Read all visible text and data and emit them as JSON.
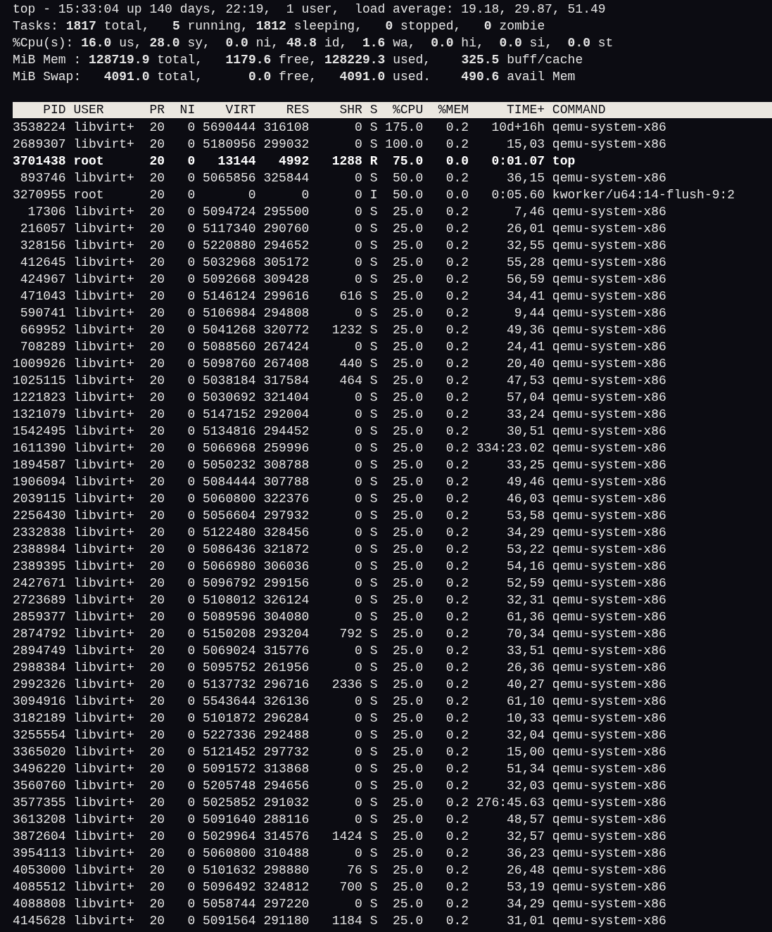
{
  "summary": [
    "top - 15:33:04 up 140 days, 22:19,  1 user,  load average: 19.18, 29.87, 51.49",
    "Tasks: **1817** total,   **5** running, **1812** sleeping,   **0** stopped,   **0** zombie",
    "%Cpu(s): **16.0** us, **28.0** sy,  **0.0** ni, **48.8** id,  **1.6** wa,  **0.0** hi,  **0.0** si,  **0.0** st",
    "MiB Mem : **128719.9** total,   **1179.6** free, **128229.3** used,    **325.5** buff/cache",
    "MiB Swap:   **4091.0** total,      **0.0** free,   **4091.0** used.    **490.6** avail Mem"
  ],
  "table": {
    "columns": [
      "PID",
      "USER",
      "PR",
      "NI",
      "VIRT",
      "RES",
      "SHR",
      "S",
      "%CPU",
      "%MEM",
      "TIME+",
      "COMMAND"
    ],
    "rows": [
      {
        "cells": [
          "3538224",
          "libvirt+",
          "20",
          "0",
          "5690444",
          "316108",
          "0",
          "S",
          "175.0",
          "0.2",
          "10d+16h",
          "qemu-system-x86"
        ],
        "highlighted": false
      },
      {
        "cells": [
          "2689307",
          "libvirt+",
          "20",
          "0",
          "5180956",
          "299032",
          "0",
          "S",
          "100.0",
          "0.2",
          "15,03",
          "qemu-system-x86"
        ],
        "highlighted": false
      },
      {
        "cells": [
          "3701438",
          "root",
          "20",
          "0",
          "13144",
          "4992",
          "1288",
          "R",
          "75.0",
          "0.0",
          "0:01.07",
          "top"
        ],
        "highlighted": true
      },
      {
        "cells": [
          "893746",
          "libvirt+",
          "20",
          "0",
          "5065856",
          "325844",
          "0",
          "S",
          "50.0",
          "0.2",
          "36,15",
          "qemu-system-x86"
        ],
        "highlighted": false
      },
      {
        "cells": [
          "3270955",
          "root",
          "20",
          "0",
          "0",
          "0",
          "0",
          "I",
          "50.0",
          "0.0",
          "0:05.60",
          "kworker/u64:14-flush-9:2"
        ],
        "highlighted": false
      },
      {
        "cells": [
          "17306",
          "libvirt+",
          "20",
          "0",
          "5094724",
          "295500",
          "0",
          "S",
          "25.0",
          "0.2",
          "7,46",
          "qemu-system-x86"
        ],
        "highlighted": false
      },
      {
        "cells": [
          "216057",
          "libvirt+",
          "20",
          "0",
          "5117340",
          "290760",
          "0",
          "S",
          "25.0",
          "0.2",
          "26,01",
          "qemu-system-x86"
        ],
        "highlighted": false
      },
      {
        "cells": [
          "328156",
          "libvirt+",
          "20",
          "0",
          "5220880",
          "294652",
          "0",
          "S",
          "25.0",
          "0.2",
          "32,55",
          "qemu-system-x86"
        ],
        "highlighted": false
      },
      {
        "cells": [
          "412645",
          "libvirt+",
          "20",
          "0",
          "5032968",
          "305172",
          "0",
          "S",
          "25.0",
          "0.2",
          "55,28",
          "qemu-system-x86"
        ],
        "highlighted": false
      },
      {
        "cells": [
          "424967",
          "libvirt+",
          "20",
          "0",
          "5092668",
          "309428",
          "0",
          "S",
          "25.0",
          "0.2",
          "56,59",
          "qemu-system-x86"
        ],
        "highlighted": false
      },
      {
        "cells": [
          "471043",
          "libvirt+",
          "20",
          "0",
          "5146124",
          "299616",
          "616",
          "S",
          "25.0",
          "0.2",
          "34,41",
          "qemu-system-x86"
        ],
        "highlighted": false
      },
      {
        "cells": [
          "590741",
          "libvirt+",
          "20",
          "0",
          "5106984",
          "294808",
          "0",
          "S",
          "25.0",
          "0.2",
          "9,44",
          "qemu-system-x86"
        ],
        "highlighted": false
      },
      {
        "cells": [
          "669952",
          "libvirt+",
          "20",
          "0",
          "5041268",
          "320772",
          "1232",
          "S",
          "25.0",
          "0.2",
          "49,36",
          "qemu-system-x86"
        ],
        "highlighted": false
      },
      {
        "cells": [
          "708289",
          "libvirt+",
          "20",
          "0",
          "5088560",
          "267424",
          "0",
          "S",
          "25.0",
          "0.2",
          "24,41",
          "qemu-system-x86"
        ],
        "highlighted": false
      },
      {
        "cells": [
          "1009926",
          "libvirt+",
          "20",
          "0",
          "5098760",
          "267408",
          "440",
          "S",
          "25.0",
          "0.2",
          "20,40",
          "qemu-system-x86"
        ],
        "highlighted": false
      },
      {
        "cells": [
          "1025115",
          "libvirt+",
          "20",
          "0",
          "5038184",
          "317584",
          "464",
          "S",
          "25.0",
          "0.2",
          "47,53",
          "qemu-system-x86"
        ],
        "highlighted": false
      },
      {
        "cells": [
          "1221823",
          "libvirt+",
          "20",
          "0",
          "5030692",
          "321404",
          "0",
          "S",
          "25.0",
          "0.2",
          "57,04",
          "qemu-system-x86"
        ],
        "highlighted": false
      },
      {
        "cells": [
          "1321079",
          "libvirt+",
          "20",
          "0",
          "5147152",
          "292004",
          "0",
          "S",
          "25.0",
          "0.2",
          "33,24",
          "qemu-system-x86"
        ],
        "highlighted": false
      },
      {
        "cells": [
          "1542495",
          "libvirt+",
          "20",
          "0",
          "5134816",
          "294452",
          "0",
          "S",
          "25.0",
          "0.2",
          "30,51",
          "qemu-system-x86"
        ],
        "highlighted": false
      },
      {
        "cells": [
          "1611390",
          "libvirt+",
          "20",
          "0",
          "5066968",
          "259996",
          "0",
          "S",
          "25.0",
          "0.2",
          "334:23.02",
          "qemu-system-x86"
        ],
        "highlighted": false
      },
      {
        "cells": [
          "1894587",
          "libvirt+",
          "20",
          "0",
          "5050232",
          "308788",
          "0",
          "S",
          "25.0",
          "0.2",
          "33,25",
          "qemu-system-x86"
        ],
        "highlighted": false
      },
      {
        "cells": [
          "1906094",
          "libvirt+",
          "20",
          "0",
          "5084444",
          "307788",
          "0",
          "S",
          "25.0",
          "0.2",
          "49,46",
          "qemu-system-x86"
        ],
        "highlighted": false
      },
      {
        "cells": [
          "2039115",
          "libvirt+",
          "20",
          "0",
          "5060800",
          "322376",
          "0",
          "S",
          "25.0",
          "0.2",
          "46,03",
          "qemu-system-x86"
        ],
        "highlighted": false
      },
      {
        "cells": [
          "2256430",
          "libvirt+",
          "20",
          "0",
          "5056604",
          "297932",
          "0",
          "S",
          "25.0",
          "0.2",
          "53,58",
          "qemu-system-x86"
        ],
        "highlighted": false
      },
      {
        "cells": [
          "2332838",
          "libvirt+",
          "20",
          "0",
          "5122480",
          "328456",
          "0",
          "S",
          "25.0",
          "0.2",
          "34,29",
          "qemu-system-x86"
        ],
        "highlighted": false
      },
      {
        "cells": [
          "2388984",
          "libvirt+",
          "20",
          "0",
          "5086436",
          "321872",
          "0",
          "S",
          "25.0",
          "0.2",
          "53,22",
          "qemu-system-x86"
        ],
        "highlighted": false
      },
      {
        "cells": [
          "2389395",
          "libvirt+",
          "20",
          "0",
          "5066980",
          "306036",
          "0",
          "S",
          "25.0",
          "0.2",
          "54,16",
          "qemu-system-x86"
        ],
        "highlighted": false
      },
      {
        "cells": [
          "2427671",
          "libvirt+",
          "20",
          "0",
          "5096792",
          "299156",
          "0",
          "S",
          "25.0",
          "0.2",
          "52,59",
          "qemu-system-x86"
        ],
        "highlighted": false
      },
      {
        "cells": [
          "2723689",
          "libvirt+",
          "20",
          "0",
          "5108012",
          "326124",
          "0",
          "S",
          "25.0",
          "0.2",
          "32,31",
          "qemu-system-x86"
        ],
        "highlighted": false
      },
      {
        "cells": [
          "2859377",
          "libvirt+",
          "20",
          "0",
          "5089596",
          "304080",
          "0",
          "S",
          "25.0",
          "0.2",
          "61,36",
          "qemu-system-x86"
        ],
        "highlighted": false
      },
      {
        "cells": [
          "2874792",
          "libvirt+",
          "20",
          "0",
          "5150208",
          "293204",
          "792",
          "S",
          "25.0",
          "0.2",
          "70,34",
          "qemu-system-x86"
        ],
        "highlighted": false
      },
      {
        "cells": [
          "2894749",
          "libvirt+",
          "20",
          "0",
          "5069024",
          "315776",
          "0",
          "S",
          "25.0",
          "0.2",
          "33,51",
          "qemu-system-x86"
        ],
        "highlighted": false
      },
      {
        "cells": [
          "2988384",
          "libvirt+",
          "20",
          "0",
          "5095752",
          "261956",
          "0",
          "S",
          "25.0",
          "0.2",
          "26,36",
          "qemu-system-x86"
        ],
        "highlighted": false
      },
      {
        "cells": [
          "2992326",
          "libvirt+",
          "20",
          "0",
          "5137732",
          "296716",
          "2336",
          "S",
          "25.0",
          "0.2",
          "40,27",
          "qemu-system-x86"
        ],
        "highlighted": false
      },
      {
        "cells": [
          "3094916",
          "libvirt+",
          "20",
          "0",
          "5543644",
          "326136",
          "0",
          "S",
          "25.0",
          "0.2",
          "61,10",
          "qemu-system-x86"
        ],
        "highlighted": false
      },
      {
        "cells": [
          "3182189",
          "libvirt+",
          "20",
          "0",
          "5101872",
          "296284",
          "0",
          "S",
          "25.0",
          "0.2",
          "10,33",
          "qemu-system-x86"
        ],
        "highlighted": false
      },
      {
        "cells": [
          "3255554",
          "libvirt+",
          "20",
          "0",
          "5227336",
          "292488",
          "0",
          "S",
          "25.0",
          "0.2",
          "32,04",
          "qemu-system-x86"
        ],
        "highlighted": false
      },
      {
        "cells": [
          "3365020",
          "libvirt+",
          "20",
          "0",
          "5121452",
          "297732",
          "0",
          "S",
          "25.0",
          "0.2",
          "15,00",
          "qemu-system-x86"
        ],
        "highlighted": false
      },
      {
        "cells": [
          "3496220",
          "libvirt+",
          "20",
          "0",
          "5091572",
          "313868",
          "0",
          "S",
          "25.0",
          "0.2",
          "51,34",
          "qemu-system-x86"
        ],
        "highlighted": false
      },
      {
        "cells": [
          "3560760",
          "libvirt+",
          "20",
          "0",
          "5205748",
          "294656",
          "0",
          "S",
          "25.0",
          "0.2",
          "32,03",
          "qemu-system-x86"
        ],
        "highlighted": false
      },
      {
        "cells": [
          "3577355",
          "libvirt+",
          "20",
          "0",
          "5025852",
          "291032",
          "0",
          "S",
          "25.0",
          "0.2",
          "276:45.63",
          "qemu-system-x86"
        ],
        "highlighted": false
      },
      {
        "cells": [
          "3613208",
          "libvirt+",
          "20",
          "0",
          "5091640",
          "288116",
          "0",
          "S",
          "25.0",
          "0.2",
          "48,57",
          "qemu-system-x86"
        ],
        "highlighted": false
      },
      {
        "cells": [
          "3872604",
          "libvirt+",
          "20",
          "0",
          "5029964",
          "314576",
          "1424",
          "S",
          "25.0",
          "0.2",
          "32,57",
          "qemu-system-x86"
        ],
        "highlighted": false
      },
      {
        "cells": [
          "3954113",
          "libvirt+",
          "20",
          "0",
          "5060800",
          "310488",
          "0",
          "S",
          "25.0",
          "0.2",
          "36,23",
          "qemu-system-x86"
        ],
        "highlighted": false
      },
      {
        "cells": [
          "4053000",
          "libvirt+",
          "20",
          "0",
          "5101632",
          "298880",
          "76",
          "S",
          "25.0",
          "0.2",
          "26,48",
          "qemu-system-x86"
        ],
        "highlighted": false
      },
      {
        "cells": [
          "4085512",
          "libvirt+",
          "20",
          "0",
          "5096492",
          "324812",
          "700",
          "S",
          "25.0",
          "0.2",
          "53,19",
          "qemu-system-x86"
        ],
        "highlighted": false
      },
      {
        "cells": [
          "4088808",
          "libvirt+",
          "20",
          "0",
          "5058744",
          "297220",
          "0",
          "S",
          "25.0",
          "0.2",
          "34,29",
          "qemu-system-x86"
        ],
        "highlighted": false
      },
      {
        "cells": [
          "4145628",
          "libvirt+",
          "20",
          "0",
          "5091564",
          "291180",
          "1184",
          "S",
          "25.0",
          "0.2",
          "31,01",
          "qemu-system-x86"
        ],
        "highlighted": false
      }
    ]
  }
}
